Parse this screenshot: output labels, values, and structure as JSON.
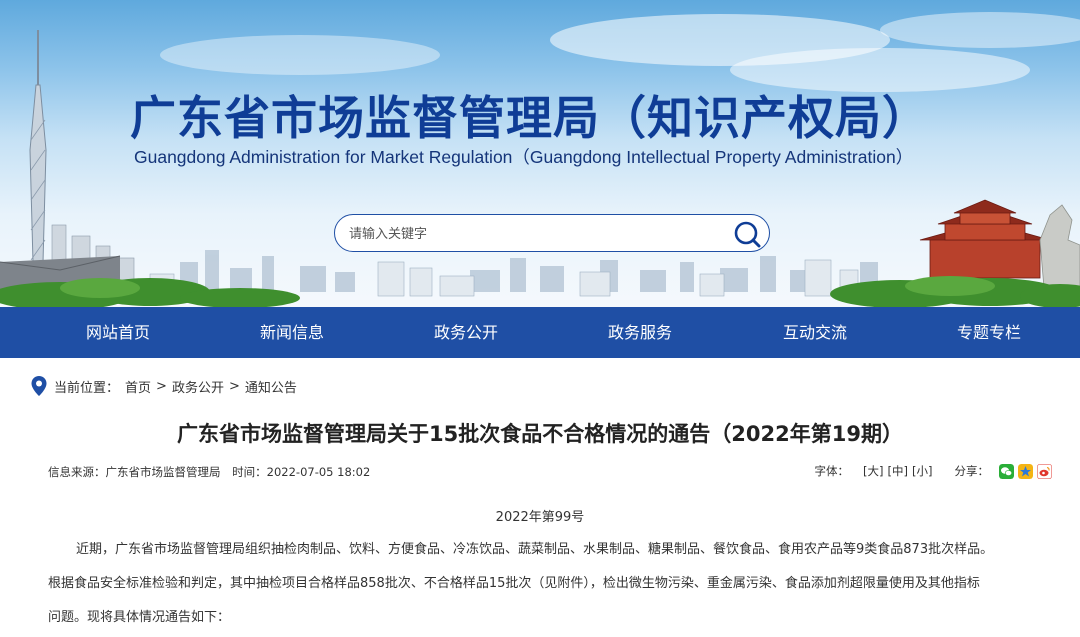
{
  "header": {
    "title": "广东省市场监督管理局（知识产权局）",
    "subtitle": "Guangdong Administration for Market Regulation（Guangdong Intellectual Property Administration）"
  },
  "search": {
    "placeholder": "请输入关键字",
    "icon": "search-icon"
  },
  "nav": {
    "items": [
      {
        "label": "网站首页"
      },
      {
        "label": "新闻信息"
      },
      {
        "label": "政务公开"
      },
      {
        "label": "政务服务"
      },
      {
        "label": "互动交流"
      },
      {
        "label": "专题专栏"
      }
    ]
  },
  "breadcrumb": {
    "prefix": "当前位置：",
    "items": [
      "首页",
      "政务公开",
      "通知公告"
    ],
    "separator": ">"
  },
  "article": {
    "title": "广东省市场监督管理局关于15批次食品不合格情况的通告（2022年第19期）",
    "source_label": "信息来源：",
    "source": "广东省市场监督管理局",
    "time_label": "时间：",
    "time": "2022-07-05 18:02",
    "font_label": "字体：",
    "font_sizes": [
      "[大]",
      "[中]",
      "[小]"
    ],
    "share_label": "分享：",
    "doc_number": "2022年第99号",
    "paragraphs": [
      "近期，广东省市场监督管理局组织抽检肉制品、饮料、方便食品、冷冻饮品、蔬菜制品、水果制品、糖果制品、餐饮食品、食用农产品等9类食品873批次样品。",
      "根据食品安全标准检验和判定，其中抽检项目合格样品858批次、不合格样品15批次（见附件），检出微生物污染、重金属污染、食品添加剂超限量使用及其他指标",
      "问题。现将具体情况通告如下："
    ]
  },
  "colors": {
    "brand_blue": "#1f4fa5",
    "title_blue": "#0f3d96"
  }
}
